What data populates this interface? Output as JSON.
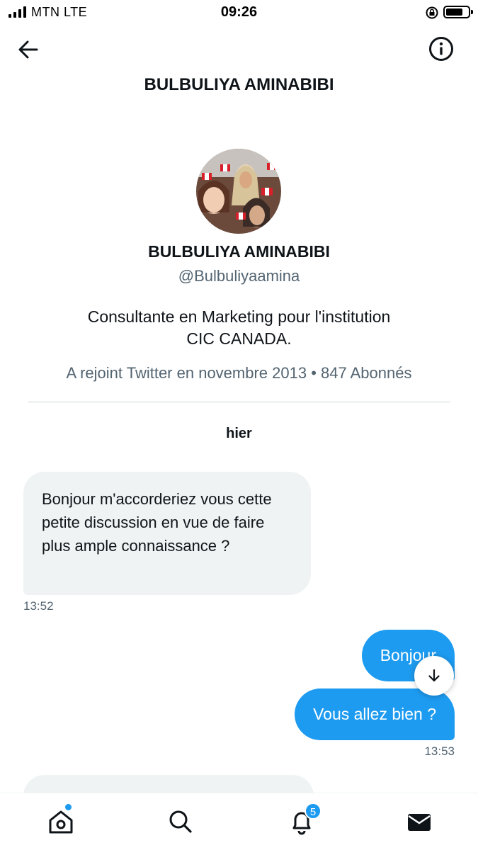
{
  "status_bar": {
    "carrier": "MTN  LTE",
    "time": "09:26",
    "battery_level": 0.75
  },
  "header": {
    "title": "BULBULIYA AMINABIBI",
    "back_icon": "arrow-left-icon",
    "info_icon": "info-icon"
  },
  "profile": {
    "name": "BULBULIYA AMINABIBI",
    "handle": "@Bulbuliyaamina",
    "bio_line1": "Consultante en Marketing pour l'institution",
    "bio_line2": "CIC CANADA.",
    "meta": "A rejoint Twitter en novembre 2013 • 847 Abonnés"
  },
  "conversation": {
    "day_label": "hier",
    "messages": [
      {
        "direction": "in",
        "text": "Bonjour m'accorderiez vous cette petite discussion en vue de faire plus ample connaissance ?",
        "time": "13:52"
      },
      {
        "direction": "out",
        "text": "Bonjour"
      },
      {
        "direction": "out",
        "text": "Vous allez bien ?",
        "time": "13:53"
      }
    ]
  },
  "bottom_nav": {
    "items": [
      {
        "icon": "home-icon",
        "has_dot": true
      },
      {
        "icon": "search-icon"
      },
      {
        "icon": "bell-icon",
        "badge": "5"
      },
      {
        "icon": "mail-icon"
      }
    ]
  },
  "colors": {
    "accent": "#1d9bf0",
    "incoming_bubble": "#eff3f4",
    "secondary_text": "#536471"
  }
}
